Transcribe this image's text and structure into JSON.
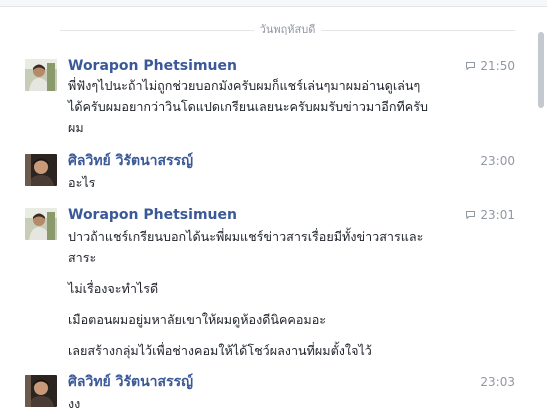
{
  "thread": {
    "date_separator": "วันพฤหัสบดี"
  },
  "messages": [
    {
      "sender": "Worapon Phetsimuen",
      "time": "21:50",
      "has_reply_icon": true,
      "lines": [
        "พี่ฟังๆไปนะถ้าไม่ถูกช่วยบอกมังครับผมก็แชร์เล่นๆมาผมอ่านดูเล่นๆ",
        "ได้ครับผมอยากว่าวินโดแปดเกรียนเลยนะครับผมรับข่าวมาอีกทีครับ",
        "ผม"
      ]
    },
    {
      "sender": "ศิลวิทย์ วิรัตนาสรรญ์",
      "time": "23:00",
      "has_reply_icon": false,
      "lines": [
        "อะไร"
      ]
    },
    {
      "sender": "Worapon Phetsimuen",
      "time": "23:01",
      "has_reply_icon": true,
      "lines": [
        "ปาวถ้าแชร์เกรียนบอกได้นะพี่ผมแชร์ข่าวสารเรื่อยมีทั้งข่าวสารและ",
        "สาระ",
        "ไม่เรื่องจะทำไรดี",
        "เมือตอนผมอยู่มหาลัยเขาให้ผมดูห้องดีนิคคอมอะ",
        "เลยสร้างกลุ่มไว้เพื่อช่างคอมให้ได้โชว์ผลงานที่ผมตั้งใจไว้"
      ]
    },
    {
      "sender": "ศิลวิทย์ วิรัตนาสรรญ์",
      "time": "23:03",
      "has_reply_icon": false,
      "lines": [
        "งง"
      ]
    }
  ]
}
